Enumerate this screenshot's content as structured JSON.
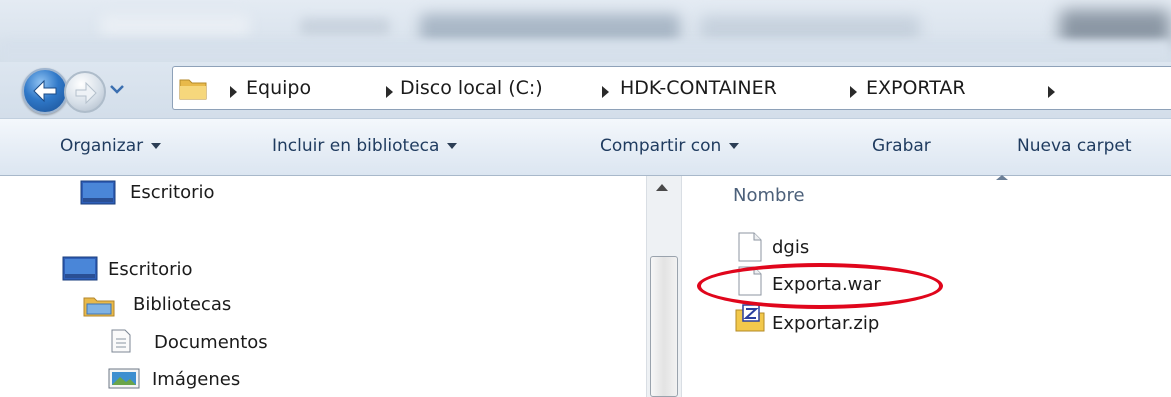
{
  "navigation": {
    "breadcrumbs": [
      "Equipo",
      "Disco local (C:)",
      "HDK-CONTAINER",
      "EXPORTAR"
    ]
  },
  "toolbar": {
    "organize": "Organizar",
    "include_library": "Incluir en biblioteca",
    "share_with": "Compartir con",
    "burn": "Grabar",
    "new_folder": "Nueva carpet"
  },
  "nav_pane": {
    "items": [
      {
        "label": "Escritorio",
        "icon": "desktop-icon"
      },
      {
        "label": "Escritorio",
        "icon": "desktop-icon"
      },
      {
        "label": "Bibliotecas",
        "icon": "libraries-icon"
      },
      {
        "label": "Documentos",
        "icon": "documents-icon"
      },
      {
        "label": "Imágenes",
        "icon": "pictures-icon"
      }
    ]
  },
  "file_list": {
    "column_header": "Nombre",
    "files": [
      {
        "name": "dgis",
        "icon": "file-icon"
      },
      {
        "name": "Exporta.war",
        "icon": "file-icon",
        "highlighted": true
      },
      {
        "name": "Exportar.zip",
        "icon": "zip-file-icon"
      }
    ]
  },
  "colors": {
    "highlight_ellipse": "#e0061c",
    "command_text": "#1f3b5f",
    "column_header": "#4c607a"
  }
}
